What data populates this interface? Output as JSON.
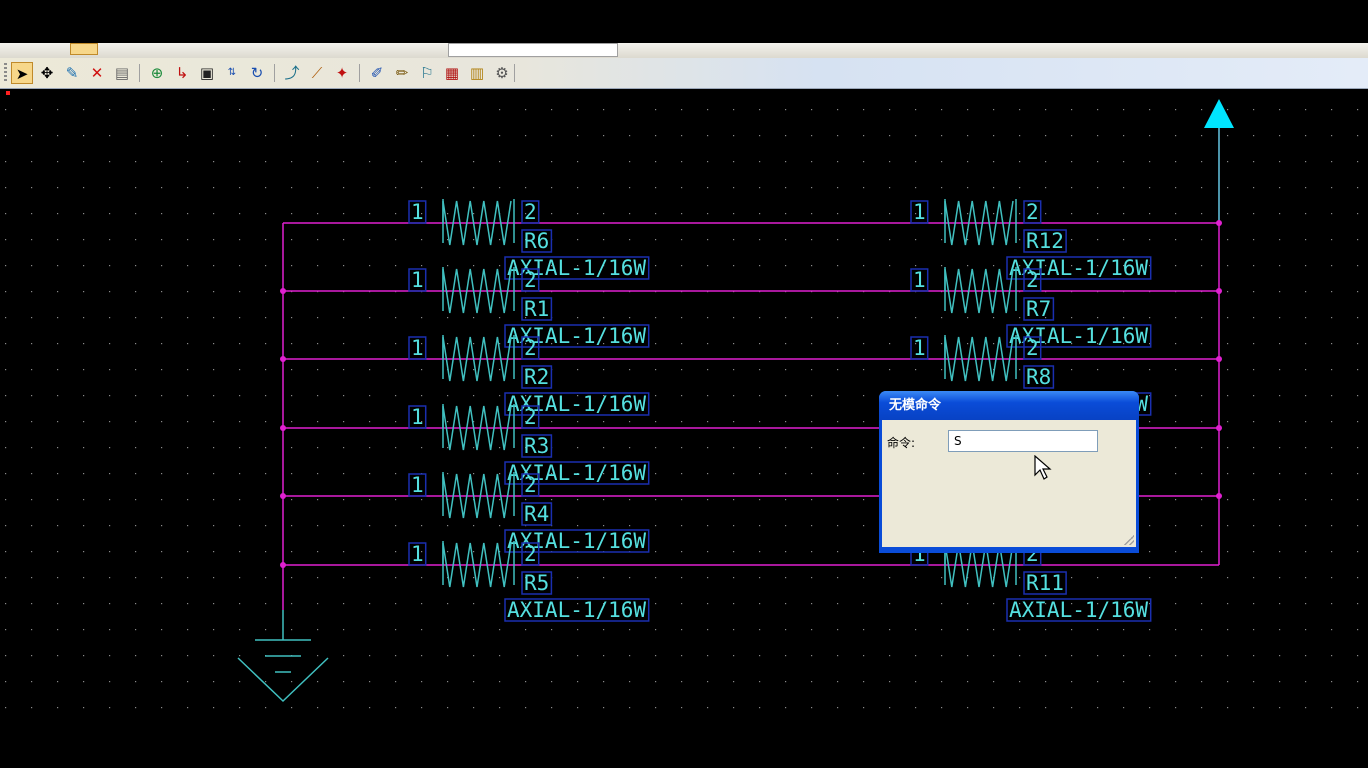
{
  "dialog": {
    "title": "无模命令",
    "command_label": "命令:",
    "command_value": "S"
  },
  "components": [
    {
      "ref": "R6",
      "part": "AXIAL-1/16W",
      "pin1": "1",
      "pin2": "2"
    },
    {
      "ref": "R1",
      "part": "AXIAL-1/16W",
      "pin1": "1",
      "pin2": "2"
    },
    {
      "ref": "R2",
      "part": "AXIAL-1/16W",
      "pin1": "1",
      "pin2": "2"
    },
    {
      "ref": "R3",
      "part": "AXIAL-1/16W",
      "pin1": "1",
      "pin2": "2"
    },
    {
      "ref": "R4",
      "part": "AXIAL-1/16W",
      "pin1": "1",
      "pin2": "2"
    },
    {
      "ref": "R5",
      "part": "AXIAL-1/16W",
      "pin1": "1",
      "pin2": "2"
    },
    {
      "ref": "R12",
      "part": "AXIAL-1/16W",
      "pin1": "1",
      "pin2": "2"
    },
    {
      "ref": "R7",
      "part": "AXIAL-1/16W",
      "pin1": "1",
      "pin2": "2"
    },
    {
      "ref": "R8",
      "part": "AXIAL-1/16W",
      "pin1": "1",
      "pin2": "2"
    },
    {
      "ref": "R11",
      "part": "AXIAL-1/16W",
      "pin1": "1",
      "pin2": "2"
    }
  ],
  "toolbar": {
    "icons": [
      "select-arrow-icon",
      "move-icon",
      "drag-icon",
      "delete-icon",
      "properties-icon",
      "add-component-icon",
      "add-connection-icon",
      "add-bus-icon",
      "swap-gate-icon",
      "swap-pin-icon",
      "split-icon",
      "add-corner-icon",
      "add-node-icon",
      "probe-icon",
      "pencil-icon",
      "attribute-icon",
      "report-icon",
      "browse-icon",
      "library-icon"
    ]
  },
  "colors": {
    "background": "#000000",
    "wire": "#e020d0",
    "component": "#40c0c0",
    "label": "#55e0e0",
    "label_box": "#1a2fb0",
    "power_arrow": "#00e5ff"
  }
}
